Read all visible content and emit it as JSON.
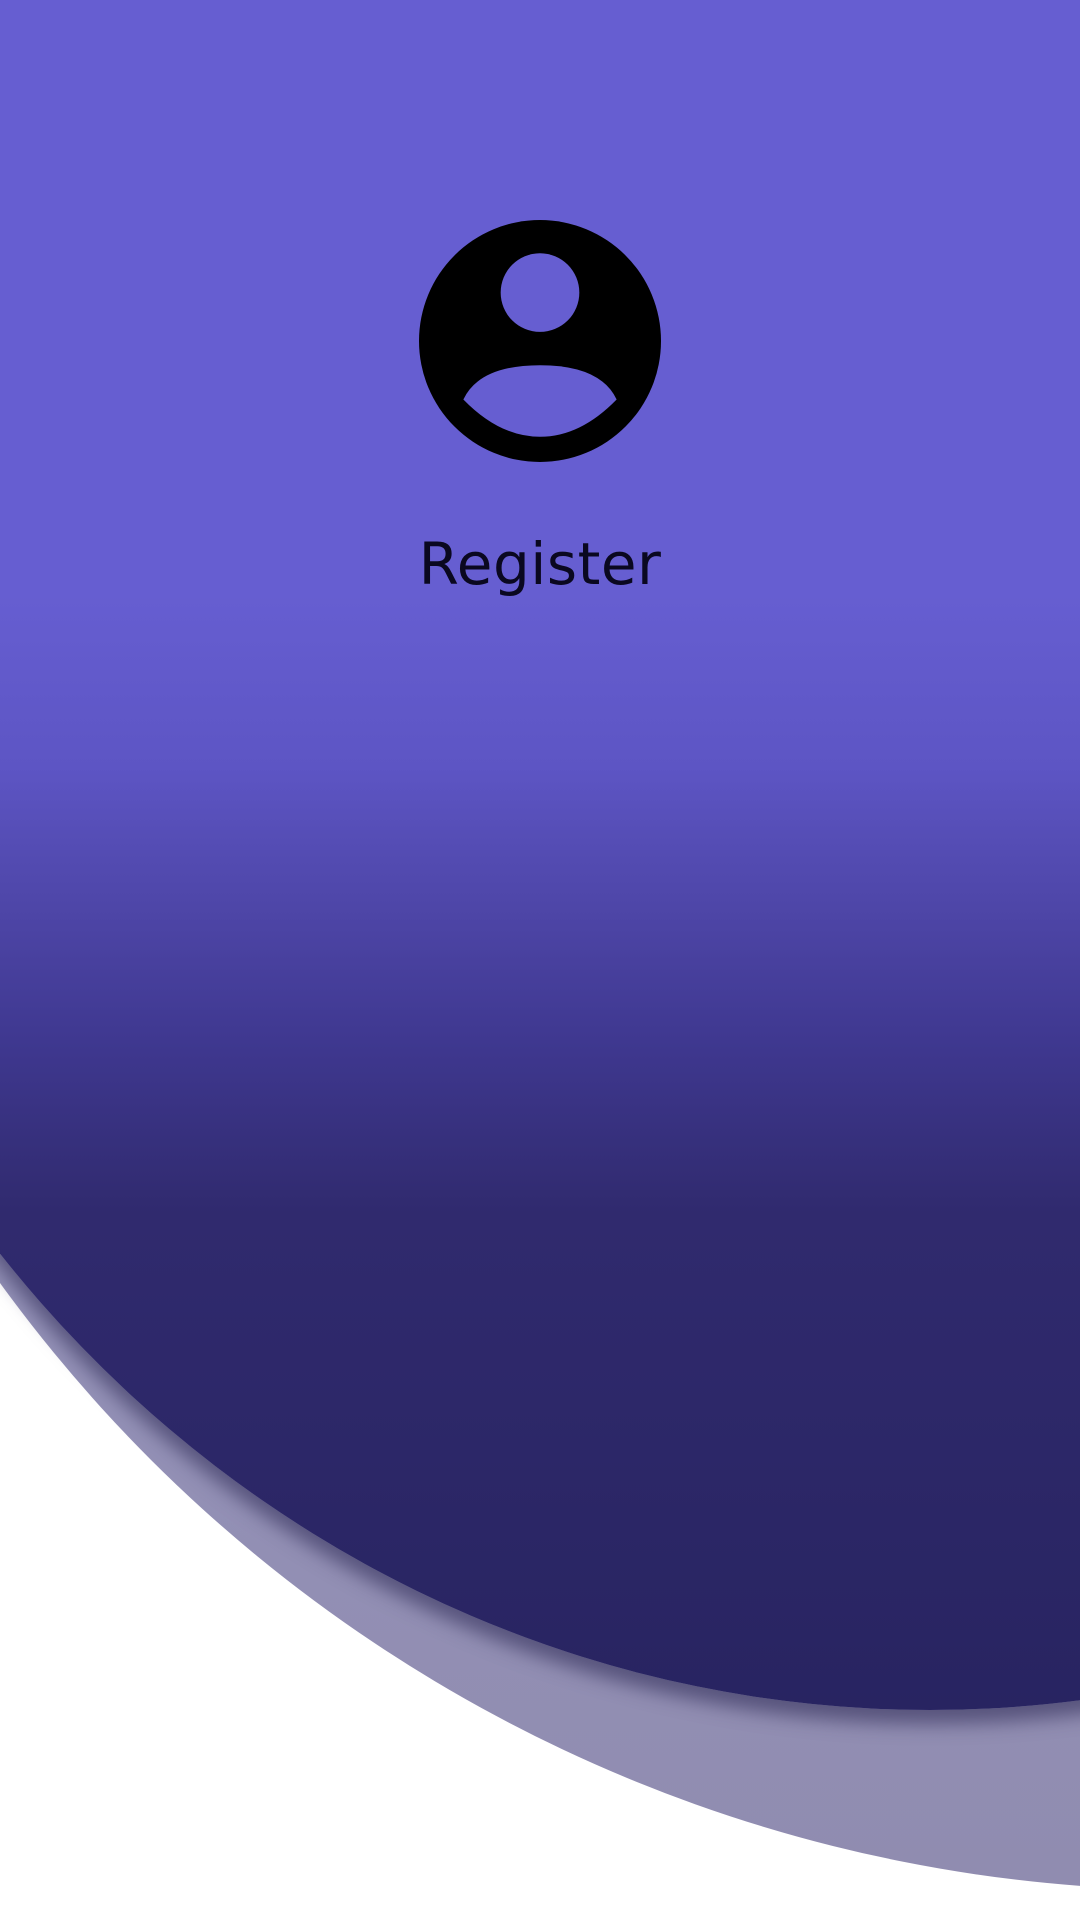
{
  "page": {
    "title": "Register"
  },
  "icons": {
    "avatar": "account-circle-icon"
  },
  "colors": {
    "primary": "#665ed1",
    "primary_dark": "#282461",
    "secondary": "#9897bf",
    "icon": "#000000",
    "text": "#0a0820"
  }
}
